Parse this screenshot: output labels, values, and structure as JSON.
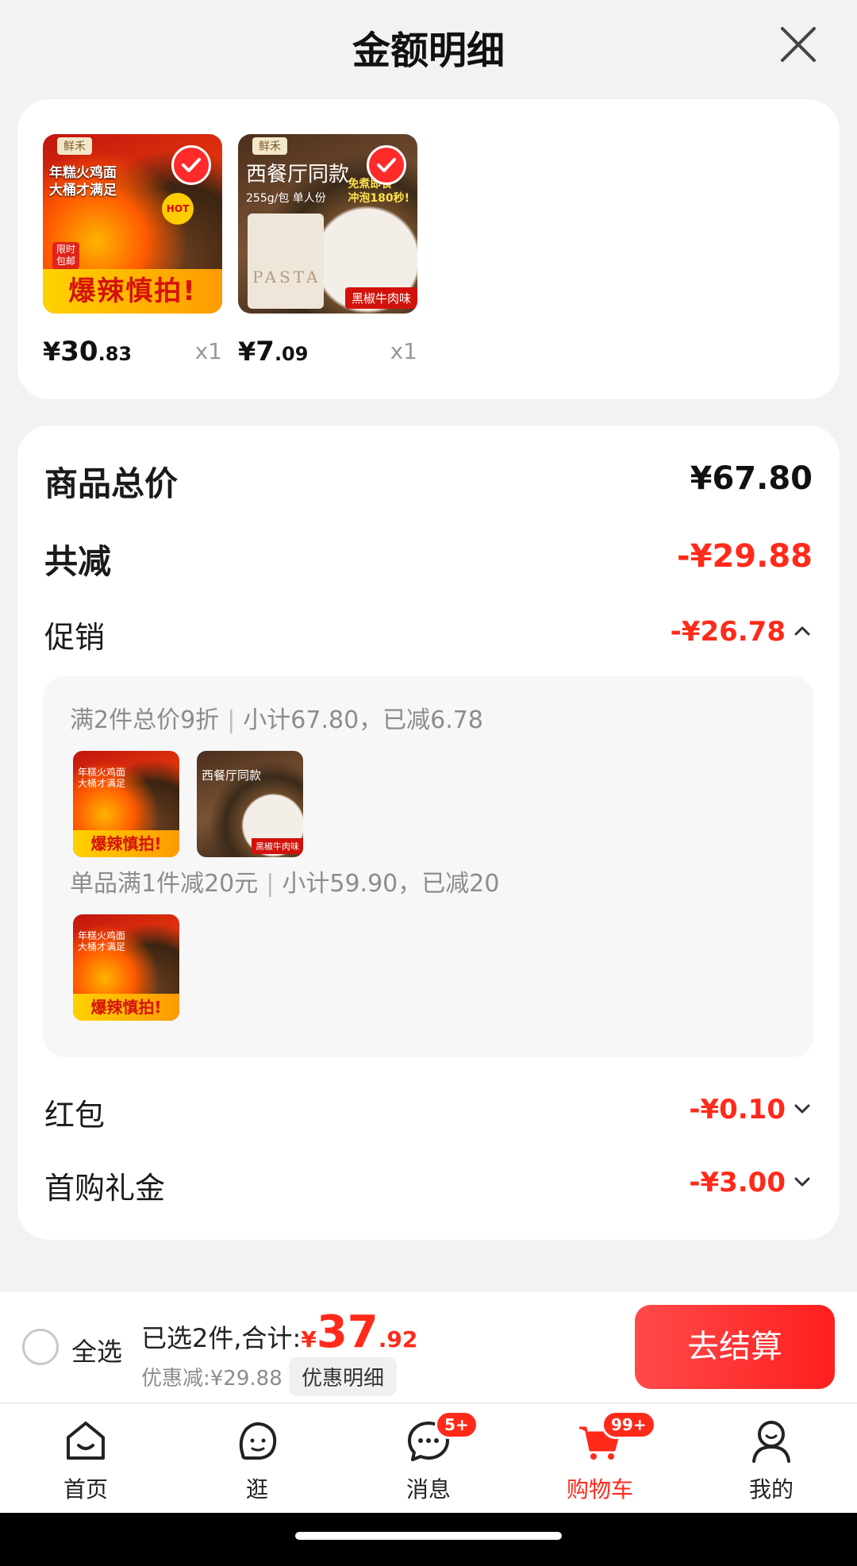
{
  "header": {
    "title": "金额明细"
  },
  "products": [
    {
      "tag": "鲜禾",
      "headline": "年糕火鸡面\n大桶才满足",
      "side_tag": "限时\n包邮",
      "banner": "爆辣慎拍!",
      "badge": "HOT",
      "price_yen": "¥",
      "price_int": "30",
      "price_dec": ".83",
      "qty": "x1",
      "selected": true
    },
    {
      "tag": "鲜禾",
      "title": "西餐厅同款",
      "subtitle": "255g/包 单人份",
      "promo": "免煮即食\n冲泡180秒!",
      "package_text": "PASTA",
      "flavor": "黑椒牛肉味",
      "price_yen": "¥",
      "price_int": "7",
      "price_dec": ".09",
      "qty": "x1",
      "selected": true
    }
  ],
  "breakdown": {
    "total": {
      "label": "商品总价",
      "value": "¥67.80"
    },
    "discount": {
      "label": "共减",
      "value": "-¥29.88"
    },
    "promo": {
      "label": "促销",
      "value": "-¥26.78",
      "rules": [
        {
          "name": "满2件总价9折",
          "detail": "小计67.80，已减6.78"
        },
        {
          "name": "单品满1件减20元",
          "detail": "小计59.90，已减20"
        }
      ]
    },
    "redpack": {
      "label": "红包",
      "value": "-¥0.10"
    },
    "first_buy": {
      "label": "首购礼金",
      "value": "-¥3.00"
    }
  },
  "checkout": {
    "select_all": "全选",
    "selected_text": "已选2件,合计:",
    "total_yen": "¥",
    "total_int": "37",
    "total_dec": ".92",
    "saved": "优惠减:¥29.88",
    "detail_button": "优惠明细",
    "pay_button": "去结算"
  },
  "tabbar": {
    "items": [
      {
        "label": "首页",
        "icon": "home-icon"
      },
      {
        "label": "逛",
        "icon": "browse-face-icon"
      },
      {
        "label": "消息",
        "icon": "message-icon",
        "badge": "5+"
      },
      {
        "label": "购物车",
        "icon": "cart-icon",
        "badge": "99+",
        "active": true
      },
      {
        "label": "我的",
        "icon": "profile-icon"
      }
    ]
  },
  "colors": {
    "accent": "#ff2a1a",
    "background": "#f2f2f2"
  }
}
